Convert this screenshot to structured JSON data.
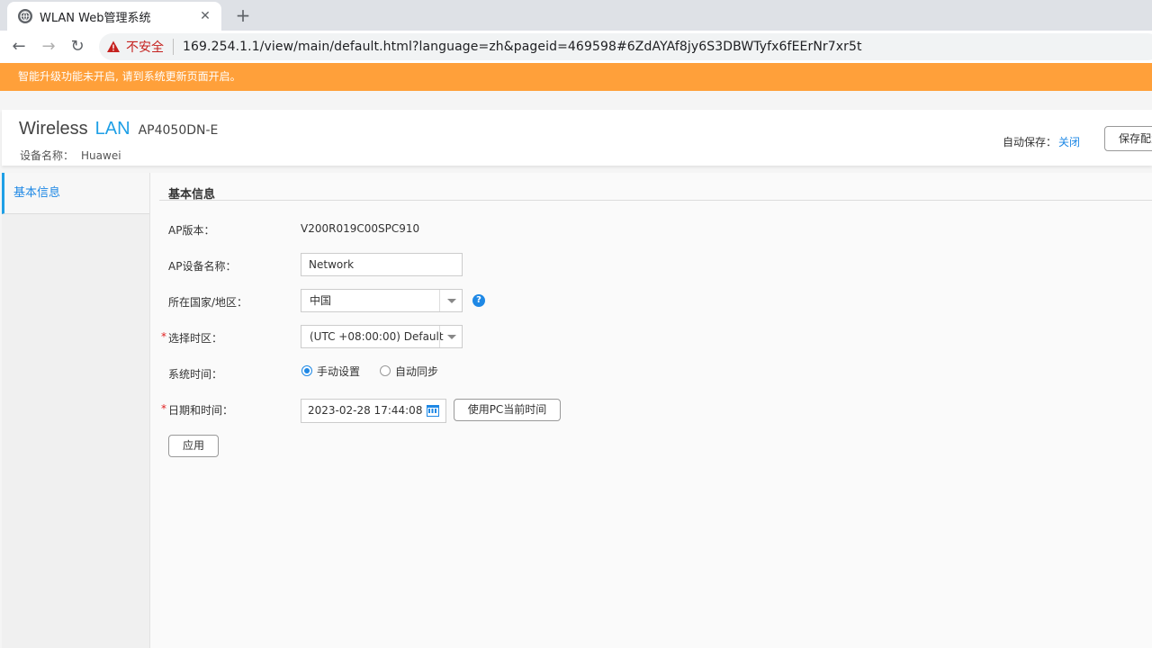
{
  "browser": {
    "tab_title": "WLAN Web管理系统",
    "tab_close": "✕",
    "new_tab": "+",
    "back": "←",
    "forward": "→",
    "reload": "↻",
    "security_label": "不安全",
    "url": "169.254.1.1/view/main/default.html?language=zh&pageid=469598#6ZdAYAf8jy6S3DBWTyfx6fEErNr7xr5t"
  },
  "notice": {
    "text": "智能升级功能未开启, 请到系统更新页面开启。"
  },
  "header": {
    "brand_wireless": "Wireless",
    "brand_lan": "LAN",
    "model": "AP4050DN-E",
    "device_name_label": "设备名称：",
    "device_name_value": "Huawei",
    "autosave_label": "自动保存：",
    "autosave_value": "关闭",
    "save_button": "保存配置"
  },
  "sidebar": {
    "items": [
      {
        "label": "基本信息"
      }
    ]
  },
  "form": {
    "section_title": "基本信息",
    "ap_version_label": "AP版本：",
    "ap_version_value": "V200R019C00SPC910",
    "ap_name_label": "AP设备名称：",
    "ap_name_value": "Network",
    "country_label": "所在国家/地区：",
    "country_value": "中国",
    "timezone_label": "选择时区：",
    "timezone_value": "(UTC +08:00:00) Default",
    "required_mark": "*",
    "system_time_label": "系统时间：",
    "radio_manual": "手动设置",
    "radio_auto": "自动同步",
    "datetime_label": "日期和时间：",
    "datetime_value": "2023-02-28 17:44:08",
    "use_pc_time_button": "使用PC当前时间",
    "apply_button": "应用",
    "help": "?"
  },
  "colors": {
    "accent": "#1e88e5",
    "notice_bg": "#ffa03a",
    "required": "#e02020"
  }
}
